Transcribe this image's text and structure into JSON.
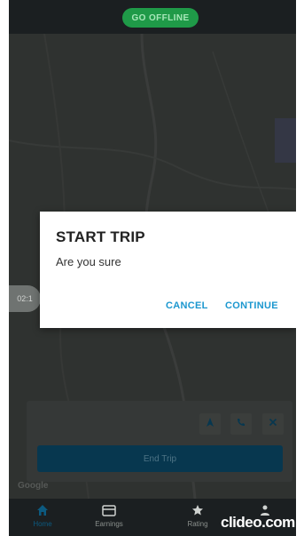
{
  "header": {
    "go_offline_label": "GO OFFLINE"
  },
  "dialog": {
    "title": "START TRIP",
    "message": "Are you sure",
    "cancel_label": "CANCEL",
    "continue_label": "CONTINUE"
  },
  "trip_timer": "02:1",
  "trip_panel": {
    "end_trip_label": "End Trip",
    "actions": [
      "navigate-icon",
      "phone-icon",
      "close-icon"
    ]
  },
  "map": {
    "attribution": "Google"
  },
  "bottom_nav": {
    "items": [
      {
        "label": "Home",
        "icon": "home-icon",
        "active": true
      },
      {
        "label": "Earnings",
        "icon": "wallet-icon",
        "active": false
      },
      {
        "label": "Rating",
        "icon": "star-icon",
        "active": false
      },
      {
        "label": "",
        "icon": "profile-icon",
        "active": false
      }
    ]
  },
  "watermark": "clideo.com",
  "colors": {
    "accent": "#1b97cf",
    "go_offline_bg": "#1f9a48",
    "end_trip_bg": "#0c5a80"
  }
}
